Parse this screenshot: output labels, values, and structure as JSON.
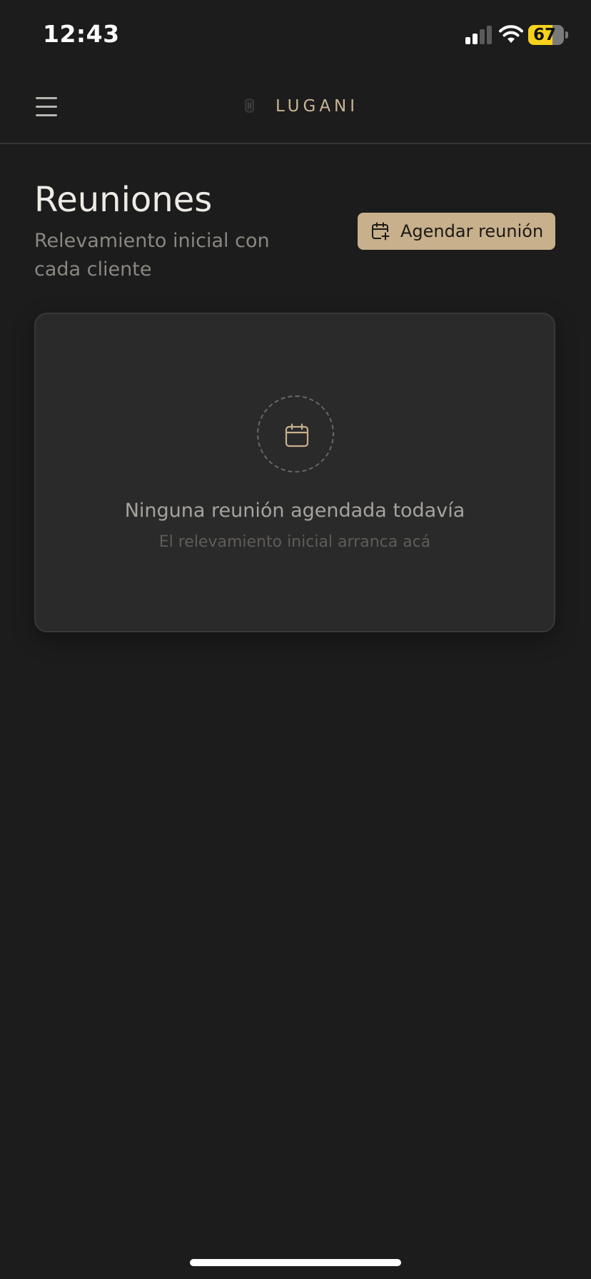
{
  "status_bar": {
    "time": "12:43",
    "battery_level": "67",
    "battery_fraction": 0.67
  },
  "header": {
    "brand_name": "LUGANI",
    "menu_icon": "hamburger-menu-icon"
  },
  "page": {
    "title": "Reuniones",
    "subtitle": "Relevamiento inicial con cada cliente",
    "schedule_button_label": "Agendar reunión",
    "schedule_button_icon": "calendar-plus-icon"
  },
  "empty_state": {
    "icon": "calendar-icon",
    "title": "Ninguna reunión agendada todavía",
    "subtitle": "El relevamiento inicial arranca acá"
  },
  "colors": {
    "background": "#1c1c1c",
    "accent": "#c8b08c",
    "card": "#2a2a2a",
    "battery": "#f6d21c"
  }
}
